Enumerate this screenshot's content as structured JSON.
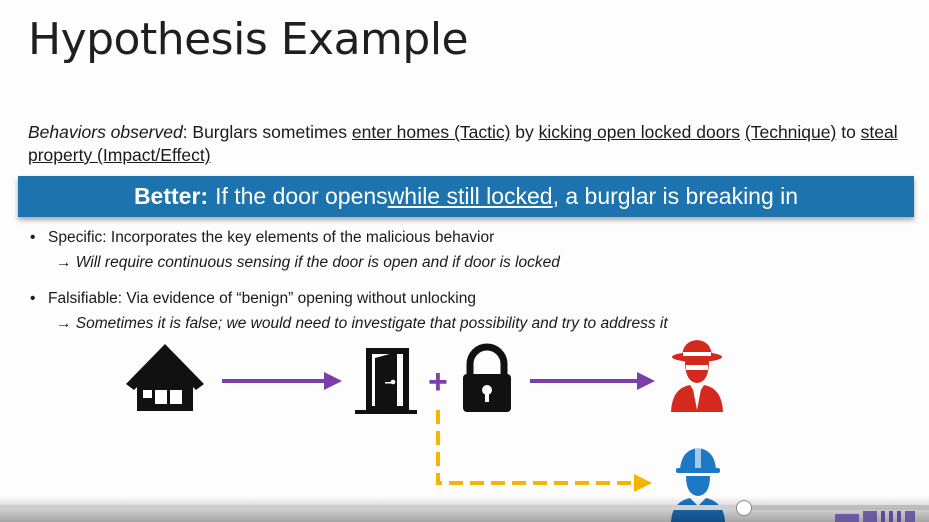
{
  "slide": {
    "title": "Hypothesis Example",
    "behaviors": {
      "label": "Behaviors observed",
      "t1": ": Burglars sometimes ",
      "u1": "enter homes (Tactic)",
      "t2": " by ",
      "u2": "kicking open locked doors",
      "t3": " ",
      "u3": "(Technique)",
      "t4": " to ",
      "u4": "steal property (Impact/Effect)"
    },
    "banner": {
      "bold": "Better:",
      "t1": "If the door opens ",
      "u1": "while still locked",
      "t2": ", a burglar is breaking in"
    },
    "bullets": [
      {
        "text": "Specific: Incorporates the key elements of the malicious behavior",
        "sub": "→ Will require continuous sensing if the door is open and if door is locked"
      },
      {
        "text": "Falsifiable: Via evidence of “benign” opening without unlocking",
        "sub": "→ Sometimes it is false; we would need to investigate that possibility and try to address it"
      }
    ],
    "diagram": {
      "plus": "+",
      "icons": [
        "house-icon",
        "door-icon",
        "padlock-icon",
        "burglar-icon",
        "firefighter-icon"
      ],
      "colors": {
        "arrow": "#7a3fa8",
        "dashed": "#f5b400",
        "burglar": "#d42a1e",
        "firefighter": "#1d78c6",
        "plus": "#7a3fa8"
      }
    }
  },
  "video": {
    "progress_fraction": 0.8
  }
}
